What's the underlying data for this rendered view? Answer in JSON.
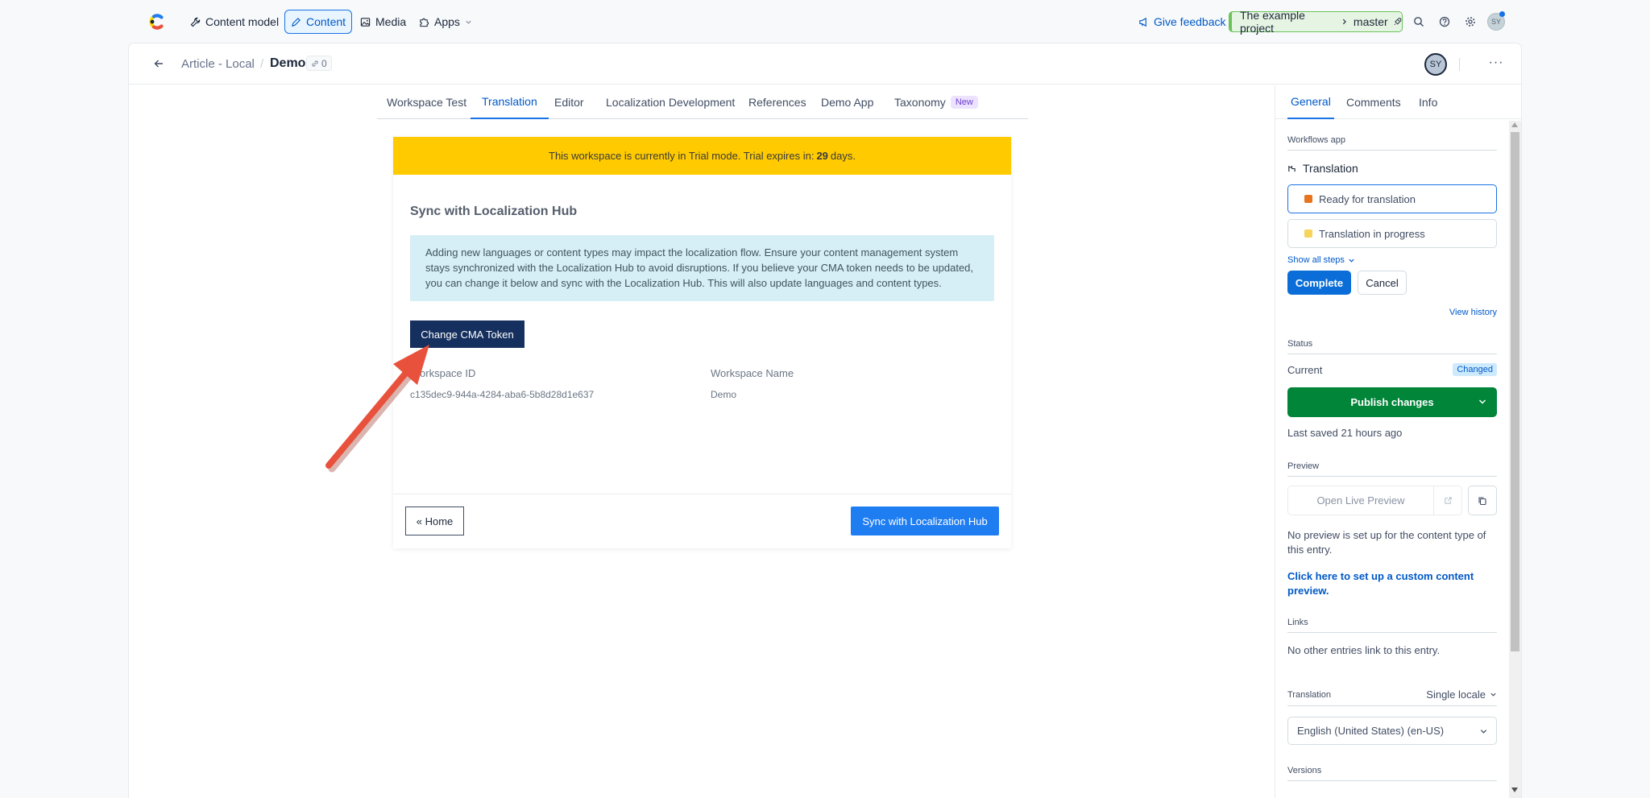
{
  "topnav": {
    "items": [
      {
        "label": "Content model",
        "icon": "wrench-icon"
      },
      {
        "label": "Content",
        "icon": "pencil-icon",
        "active": true
      },
      {
        "label": "Media",
        "icon": "image-icon"
      },
      {
        "label": "Apps",
        "icon": "puzzle-icon"
      }
    ],
    "feedback": "Give feedback",
    "project": "The example project",
    "environment": "master",
    "avatar": "SY"
  },
  "header": {
    "breadcrumb_parent": "Article - Local",
    "breadcrumb_sep": "/",
    "entry_title": "Demo",
    "link_count": "0",
    "avatar": "SY",
    "more": "···"
  },
  "tabs": [
    {
      "label": "Workspace Test"
    },
    {
      "label": "Translation",
      "active": true
    },
    {
      "label": "Editor"
    },
    {
      "label": "Localization Development"
    },
    {
      "label": "References"
    },
    {
      "label": "Demo App"
    },
    {
      "label": "Taxonomy",
      "badge": "New"
    }
  ],
  "app": {
    "trial_prefix": "This workspace is currently in Trial mode. Trial expires in:",
    "trial_days": "29",
    "trial_suffix": "days.",
    "title": "Sync with Localization Hub",
    "info": "Adding new languages or content types may impact the localization flow. Ensure your content management system stays synchronized with the Localization Hub to avoid disruptions. If you believe your CMA token needs to be updated, you can change it below and sync with the Localization Hub. This will also update languages and content types.",
    "change_token": "Change CMA Token",
    "workspace_id_label": "Workspace ID",
    "workspace_id": "c135dec9-944a-4284-aba6-5b8d28d1e637",
    "workspace_name_label": "Workspace Name",
    "workspace_name": "Demo",
    "home": "« Home",
    "sync": "Sync with Localization Hub"
  },
  "sidebar": {
    "tabs": [
      {
        "label": "General",
        "active": true
      },
      {
        "label": "Comments"
      },
      {
        "label": "Info"
      }
    ],
    "workflows_head": "Workflows app",
    "workflow_name": "Translation",
    "steps": [
      {
        "label": "Ready for translation",
        "color": "#e8741e"
      },
      {
        "label": "Translation in progress",
        "color": "#f5d55a"
      }
    ],
    "show_all_steps": "Show all steps",
    "complete": "Complete",
    "cancel": "Cancel",
    "view_history": "View history",
    "status_head": "Status",
    "current_label": "Current",
    "changed": "Changed",
    "publish": "Publish changes",
    "last_saved": "Last saved 21 hours ago",
    "preview_head": "Preview",
    "open_preview": "Open Live Preview",
    "no_preview": "No preview is set up for the content type of this entry.",
    "setup_preview": "Click here to set up a custom content preview.",
    "links_head": "Links",
    "no_links": "No other entries link to this entry.",
    "translation_head": "Translation",
    "locale_mode": "Single locale",
    "locale": "English (United States) (en-US)",
    "versions_head": "Versions"
  },
  "colors": {
    "accent": "#1872e6",
    "publish": "#008539",
    "trial": "#ffca00",
    "token_button": "#15305e",
    "arrow": "#e8523c"
  }
}
